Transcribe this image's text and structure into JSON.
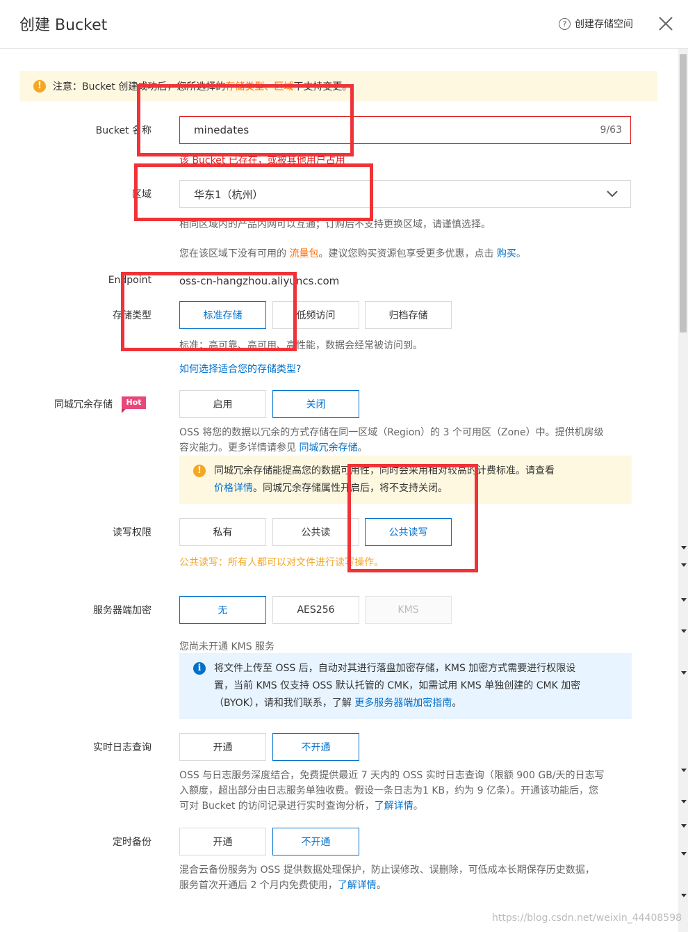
{
  "header": {
    "title": "创建 Bucket",
    "help_label": "创建存储空间"
  },
  "notice": {
    "prefix": "注意：Bucket 创建成功后，您所选择的 ",
    "highlight": "存储类型、区域",
    "suffix": " 不支持变更。"
  },
  "bucket_name": {
    "label": "Bucket 名称",
    "value": "minedates",
    "counter": "9/63",
    "error": "该 Bucket 已存在，或被其他用户占用"
  },
  "region": {
    "label": "区域",
    "value": "华东1（杭州）",
    "hint": "相同区域内的产品内网可以互通；订购后不支持更换区域，请谨慎选择。",
    "package_prefix": "您在该区域下没有可用的 ",
    "package_link": "流量包",
    "package_middle": "。建议您购买资源包享受更多优惠，点击 ",
    "buy_link": "购买",
    "package_suffix": "。"
  },
  "endpoint": {
    "label": "Endpoint",
    "value": "oss-cn-hangzhou.aliyuncs.com"
  },
  "storage_class": {
    "label": "存储类型",
    "options": [
      "标准存储",
      "低频访问",
      "归档存储"
    ],
    "hint": "标准：高可靠、高可用、高性能，数据会经常被访问到。",
    "link": "如何选择适合您的存储类型?"
  },
  "zrs": {
    "label": "同城冗余存储",
    "badge": "Hot",
    "options": [
      "启用",
      "关闭"
    ],
    "desc1": "OSS 将您的数据以冗余的方式存储在同一区域（Region）的 3 个可用区（Zone）中。提供机房级",
    "desc2": "容灾能力。更多详情请参见 ",
    "desc_link": "同城冗余存储",
    "desc_end": "。",
    "warn_line1": "同城冗余存储能提高您的数据可用性，同时会采用相对较高的计费标准。请查看",
    "warn_link": "价格详情",
    "warn_line2": "。同城冗余存储属性开启后，将不支持关闭。"
  },
  "acl": {
    "label": "读写权限",
    "options": [
      "私有",
      "公共读",
      "公共读写"
    ],
    "warning": "公共读写：所有人都可以对文件进行读写操作。"
  },
  "encryption": {
    "label": "服务器端加密",
    "options": [
      "无",
      "AES256",
      "KMS"
    ],
    "kms_hint": "您尚未开通 KMS 服务",
    "info1": "将文件上传至 OSS 后，自动对其进行落盘加密存储，KMS 加密方式需要进行权限设",
    "info2": "置，当前 KMS 仅支持 OSS 默认托管的 CMK，如需试用 KMS 单独创建的 CMK 加密",
    "info3": "（BYOK），请和我们联系，了解 ",
    "info_link": "更多服务器端加密指南",
    "info_end": "。"
  },
  "realtime_log": {
    "label": "实时日志查询",
    "options": [
      "开通",
      "不开通"
    ],
    "desc1": "OSS 与日志服务深度结合，免费提供最近 7 天内的 OSS 实时日志查询（限额 900 GB/天的日志写",
    "desc2": "入额度，超出部分由日志服务单独收费。假设一条日志为1 KB，约为 9 亿条）。开通该功能后，您",
    "desc3": "可对 Bucket 的访问记录进行实时查询分析，",
    "desc_link": "了解详情",
    "desc_end": "。"
  },
  "backup": {
    "label": "定时备份",
    "options": [
      "开通",
      "不开通"
    ],
    "desc1": "混合云备份服务为 OSS 提供数据处理保护，防止误修改、误删除，可低成本长期保存历史数据，",
    "desc2": "服务首次开通后 2 个月内免费使用，",
    "desc_link": "了解详情",
    "desc_end": "。"
  },
  "watermark": "https://blog.csdn.net/weixin_44408598",
  "colors": {
    "accent": "#0070cc",
    "error": "#e02020",
    "highlight": "#ff6a00",
    "warning_bg": "#fff8e1",
    "info_bg": "#e8f4ff",
    "annotation": "#ef3338"
  }
}
